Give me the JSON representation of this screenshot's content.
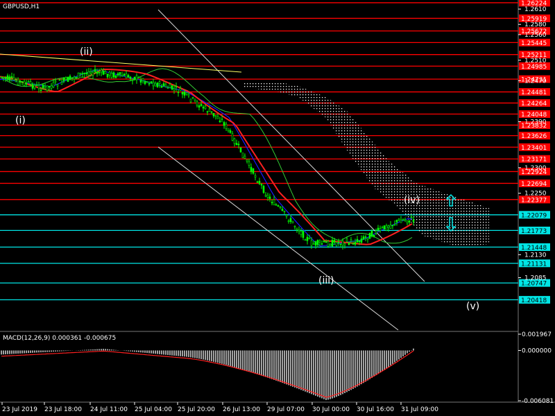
{
  "chart_data": {
    "type": "candlestick",
    "title": "GBPUSD,H1",
    "price_axis": {
      "range": [
        1.198,
        1.2625
      ],
      "tick_labels": [
        "1.2610",
        "1.2580",
        "1.2560",
        "1.2510",
        "1.2470",
        "1.2390",
        "1.2300",
        "1.2250",
        "1.2130",
        "1.2085"
      ]
    },
    "time_axis_labels": [
      "23 Jul 2019",
      "23 Jul 18:00",
      "24 Jul 11:00",
      "25 Jul 04:00",
      "25 Jul 20:00",
      "26 Jul 13:00",
      "29 Jul 07:00",
      "30 Jul 00:00",
      "30 Jul 16:00",
      "31 Jul 09:00"
    ],
    "support_resistance": {
      "red": [
        "1.26224",
        "1.25919",
        "1.25672",
        "1.25445",
        "1.25211",
        "1.24985",
        "1.24731",
        "1.24481",
        "1.24264",
        "1.24048",
        "1.23832",
        "1.23626",
        "1.23401",
        "1.23171",
        "1.22924",
        "1.22694",
        "1.22377"
      ],
      "cyan": [
        "1.22079",
        "1.21773",
        "1.21448",
        "1.21131",
        "1.20747",
        "1.20418"
      ]
    },
    "wave_labels": [
      "(i)",
      "(ii)",
      "(iii)",
      "(iv)",
      "(v)"
    ],
    "price": [
      {
        "x": "23 Jul 2019",
        "y": 1.2478
      },
      {
        "x": "23 Jul 18:00",
        "y": 1.2455
      },
      {
        "x": "24 Jul 11:00",
        "y": 1.2488
      },
      {
        "x": "25 Jul 04:00",
        "y": 1.2476
      },
      {
        "x": "25 Jul 20:00",
        "y": 1.2452
      },
      {
        "x": "26 Jul 13:00",
        "y": 1.2392
      },
      {
        "x": "29 Jul 07:00",
        "y": 1.2246
      },
      {
        "x": "30 Jul 00:00",
        "y": 1.2151
      },
      {
        "x": "30 Jul 16:00",
        "y": 1.2155
      },
      {
        "x": "31 Jul 09:00",
        "y": 1.2198
      }
    ],
    "macd": {
      "label": "MACD(12,26,9) 0.000361 -0.000675",
      "range": [
        -0.006081,
        0.001967
      ],
      "tick_labels": [
        "0.001967",
        "0.000000",
        "-0.006081"
      ]
    },
    "grid": false,
    "colors": {
      "background": "#000000",
      "red_level": "#ff0000",
      "cyan_level": "#00e5e5",
      "candle": "#00ff00",
      "ma_red": "#ff2020",
      "ma_blue": "#1a1aff",
      "kumo": "#ffffff",
      "trend_yellow": "#ffff66"
    }
  }
}
